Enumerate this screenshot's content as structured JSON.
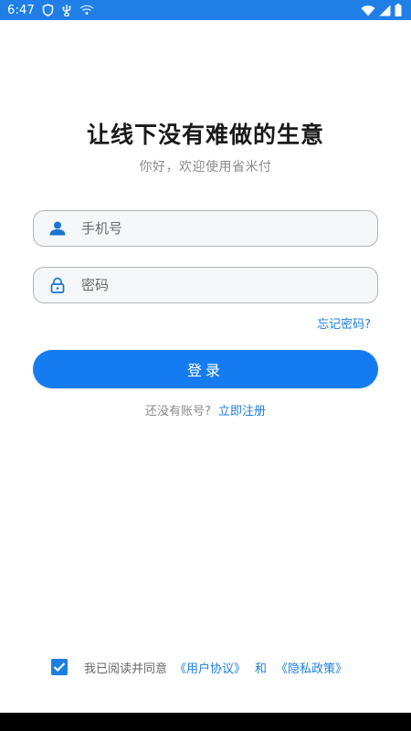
{
  "status_bar": {
    "time": "6:47",
    "icons": [
      "shield-icon",
      "usb-icon",
      "wifi-calling-icon",
      "wifi-icon",
      "signal-icon",
      "battery-icon"
    ],
    "background": "#1f7fe6"
  },
  "header": {
    "title": "让线下没有难做的生意",
    "subtitle": "你好，欢迎使用省米付"
  },
  "form": {
    "phone_placeholder": "手机号",
    "password_placeholder": "密码",
    "forgot_label": "忘记密码?",
    "login_label": "登录"
  },
  "register": {
    "prompt": "还没有账号?",
    "link": "立即注册"
  },
  "agreement": {
    "checked": true,
    "prefix": "我已阅读并同意",
    "user_agreement": "《用户协议》",
    "conjunction": "和",
    "privacy_policy": "《隐私政策》"
  },
  "colors": {
    "accent": "#147cf0",
    "link": "#1e7fe0",
    "field_border": "#b5b5b5",
    "field_bg": "#f5f6f8"
  }
}
